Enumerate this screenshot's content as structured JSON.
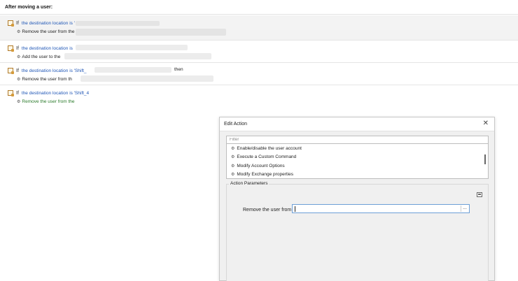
{
  "header": {
    "title": "After moving a user:"
  },
  "rules": [
    {
      "keyword": "If",
      "condition": "the destination location is '",
      "action_icon": "gear",
      "action": "Remove the user from the",
      "action_color": "dark"
    },
    {
      "keyword": "If",
      "condition": "the destination location is",
      "action_icon": "gear",
      "action": "Add the user to the",
      "action_color": "dark"
    },
    {
      "keyword": "If",
      "condition": "the destination location is 'Shift_",
      "then": "then",
      "action_icon": "gear",
      "action": "Remove the user from th",
      "action_color": "dark"
    },
    {
      "keyword": "If",
      "condition": "the destination location is 'Shift_4",
      "action_icon": "gear",
      "action": "Remove the user from the",
      "action_color": "green"
    }
  ],
  "dialog": {
    "title": "Edit Action",
    "close_glyph": "✕",
    "filter_placeholder": "Filter",
    "actions": [
      "Enable/disable the user account",
      "Execute a Custom Command",
      "Modify Account Options",
      "Modify Exchange properties"
    ],
    "params_group_label": "Action Parameters",
    "field_label": "Remove the user from",
    "field_value": "",
    "browse_label": "..."
  },
  "colors": {
    "link": "#1f56b6",
    "green_text": "#2a7a2a",
    "focus_border": "#6d9fd6"
  }
}
